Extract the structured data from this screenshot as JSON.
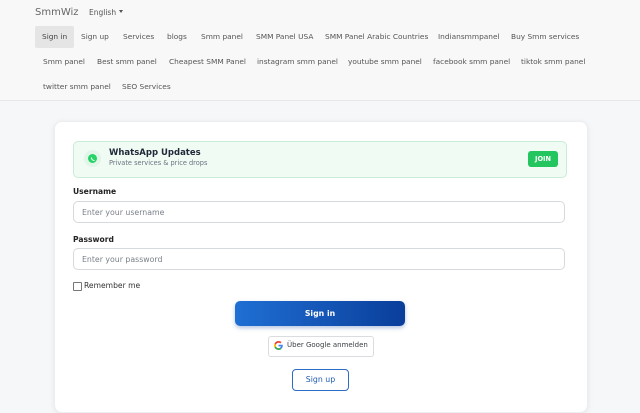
{
  "brand": "SmmWiz",
  "language": "English",
  "nav": {
    "links": [
      "Sign in",
      "Sign up",
      "Services",
      "blogs",
      "Smm panel",
      "SMM Panel USA",
      "SMM Panel Arabic Countries",
      "Indiansmmpanel",
      "Buy Smm services",
      "Smm panel",
      "Best smm panel",
      "Cheapest SMM Panel",
      "instagram smm panel",
      "youtube smm panel",
      "facebook smm panel",
      "tiktok smm panel",
      "twitter smm panel",
      "SEO Services"
    ],
    "active": "Sign in"
  },
  "whatsapp": {
    "title": "WhatsApp Updates",
    "subtitle": "Private services & price drops",
    "join_label": "JOIN",
    "icon": "whatsapp-icon",
    "accent": "#22c55e"
  },
  "form": {
    "username_label": "Username",
    "username_placeholder": "Enter your username",
    "password_label": "Password",
    "password_placeholder": "Enter your password",
    "remember_label": "Remember me",
    "signin_label": "Sign in",
    "google_label": "Über Google anmelden",
    "signup_label": "Sign up"
  },
  "colors": {
    "primary_start": "#1f6fd4",
    "primary_end": "#0a3e9a"
  }
}
